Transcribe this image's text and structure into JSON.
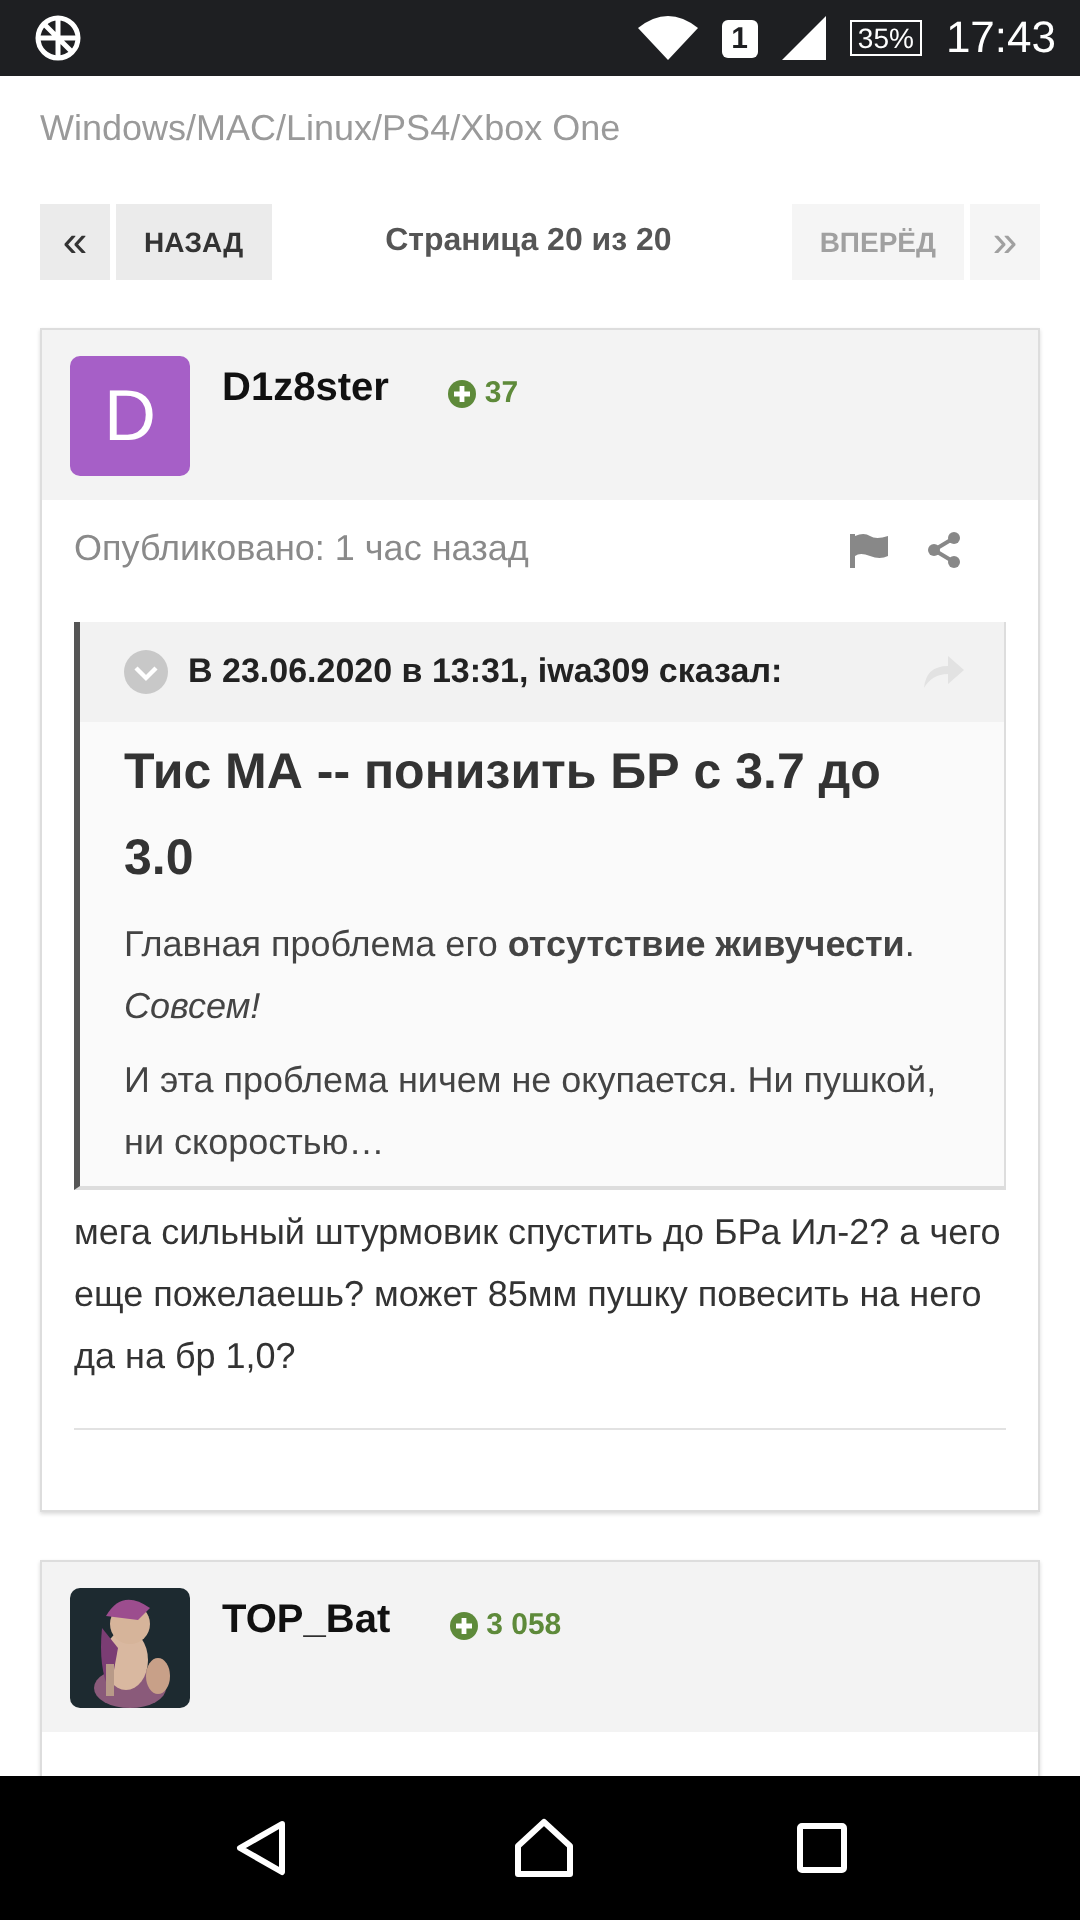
{
  "status_bar": {
    "sim": "1",
    "battery": "35%",
    "time": "17:43"
  },
  "topic_source": "Windows/MAC/Linux/PS4/Xbox One",
  "pagination": {
    "buttons": [
      {
        "kind": "icon",
        "label": "«",
        "disabled": false
      },
      {
        "kind": "text",
        "label": "НАЗАД",
        "disabled": false
      },
      {
        "kind": "info",
        "label": "Страница 20 из 20"
      },
      {
        "kind": "text",
        "label": "ВПЕРЁД",
        "disabled": true
      },
      {
        "kind": "icon",
        "label": "»",
        "disabled": true
      }
    ]
  },
  "posts": [
    {
      "author": "D1z8ster",
      "avatar": {
        "kind": "letter",
        "letter": "D",
        "color": "#a65fc7"
      },
      "reputation": "37",
      "published": "Опубликовано: 1 час назад",
      "quote": {
        "header": "В 23.06.2020 в 13:31, iwa309 сказал:",
        "title": "Тис МА -- понизить БР с 3.7 до 3.0",
        "body": [
          "Главная проблема его **отсутствие живучести**. *Совсем!*",
          "И эта проблема ничем не окупается. Ни пушкой, ни скоростью…"
        ]
      },
      "content": "мега сильный штурмовик спустить до БРа Ил-2? а чего еще пожелаешь? может 85мм пушку повесить на него да на бр 1,0?"
    },
    {
      "author": "TOP_Bat",
      "reputation": "3 058"
    }
  ]
}
